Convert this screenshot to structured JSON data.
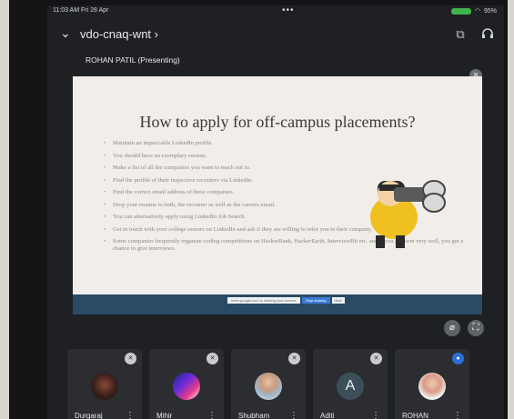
{
  "status": {
    "time": "11:03 AM  Fri 28 Apr",
    "dots": "•••",
    "battery_text": "95%"
  },
  "meeting": {
    "code": "vdo-cnaq-wnt",
    "code_arrow": "›",
    "presenter": "ROHAN PATIL (Presenting)"
  },
  "slide": {
    "title": "How to apply for off-campus placements?",
    "bullets": [
      "Maintain an impeccable LinkedIn profile.",
      "You should have an exemplary resume.",
      "Make a list of all the companies you want to reach out to.",
      "Find the profile of their respective recruiters via LinkedIn.",
      "Find the correct email address of these companies.",
      "Drop your resume to both, the recruiter as well as the careers email.",
      "You can alternatively apply using LinkedIn Job Search.",
      "Get in touch with your college seniors on LinkedIn and ask if they are willing to refer you in their company.",
      "Some companies frequently organize coding competitions on HackerRank, HackerEarth, InterviewBit etc. and if you perform very well, you get a chance to give interviews."
    ],
    "controls": {
      "sharing_text": "meet.google.com is sharing your screen.",
      "stop_label": "Stop sharing",
      "hide_label": "Hide"
    }
  },
  "participants": [
    {
      "name": "Durgaraj",
      "avatar": "photo"
    },
    {
      "name": "Mihir",
      "avatar": "graphic"
    },
    {
      "name": "Shubham",
      "avatar": "photo"
    },
    {
      "name": "Aditi",
      "avatar": "letter",
      "letter": "A"
    },
    {
      "name": "ROHAN",
      "avatar": "photo"
    }
  ],
  "colors": {
    "screen_bg": "#1f2023",
    "tile_bg": "#2b2d31",
    "slide_bg": "#f1eeea",
    "slide_footer": "#2a4b66",
    "accent_blue": "#2c6fd6",
    "battery_green": "#3fb64a"
  },
  "icons": [
    "chevron-down-icon",
    "camera-switch-icon",
    "headphones-icon",
    "mic-off-icon",
    "pin-off-icon",
    "fullscreen-icon",
    "more-vert-icon"
  ]
}
